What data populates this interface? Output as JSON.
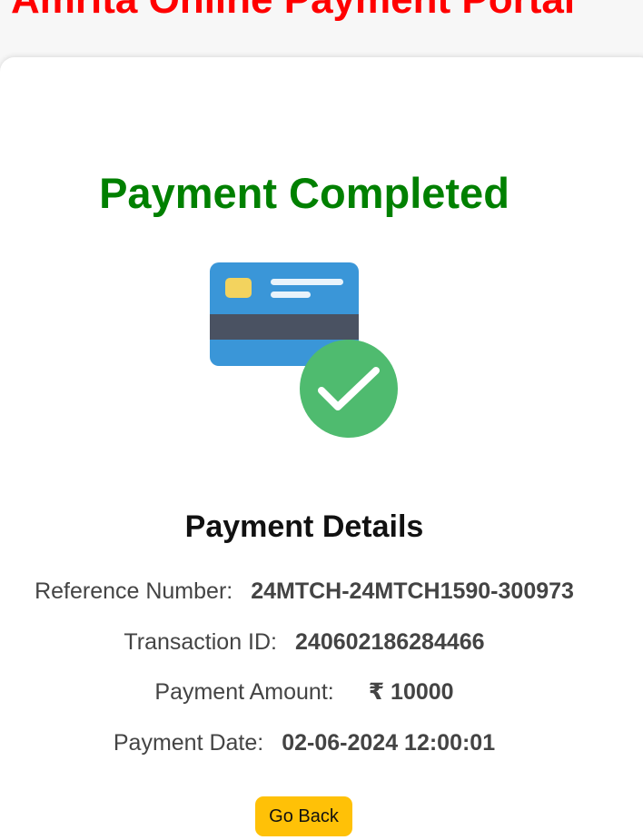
{
  "header": {
    "portal_title": "Amrita Online Payment Portal"
  },
  "status": {
    "title": "Payment Completed",
    "title_color": "#008000",
    "illustration": "credit-card-check-icon"
  },
  "details": {
    "title": "Payment Details",
    "rows": [
      {
        "label": "Reference Number:",
        "value": "24MTCH-24MTCH1590-300973"
      },
      {
        "label": "Transaction ID:",
        "value": "240602186284466"
      },
      {
        "label": "Payment Amount:",
        "value": "₹ 10000"
      },
      {
        "label": "Payment Date:",
        "value": "02-06-2024 12:00:01"
      }
    ]
  },
  "actions": {
    "go_back_label": "Go Back",
    "go_back_color": "#ffc107"
  },
  "colors": {
    "portal_title": "#ff0000",
    "card_blue": "#3a96d8",
    "card_stripe": "#4a5262",
    "card_chip": "#f3d35e",
    "check_green": "#4fbb6f"
  }
}
